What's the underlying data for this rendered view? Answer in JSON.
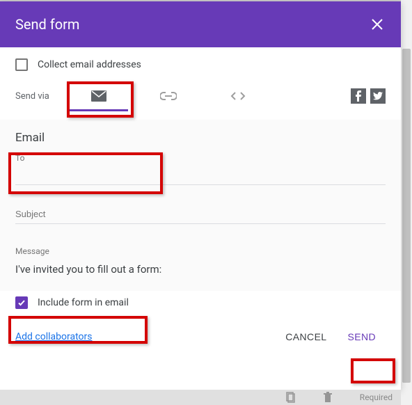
{
  "header": {
    "title": "Send form"
  },
  "collect": {
    "label": "Collect email addresses",
    "checked": false
  },
  "sendvia": {
    "label": "Send via"
  },
  "email": {
    "title": "Email",
    "to_label": "To",
    "to_value": "",
    "subject_label": "Subject",
    "subject_value": "",
    "message_label": "Message",
    "message_value": "I've invited you to fill out a form:"
  },
  "include": {
    "label": "Include form in email",
    "checked": true
  },
  "footer": {
    "add_collaborators": "Add collaborators",
    "cancel": "CANCEL",
    "send": "SEND"
  },
  "bottom": {
    "required": "Required"
  }
}
